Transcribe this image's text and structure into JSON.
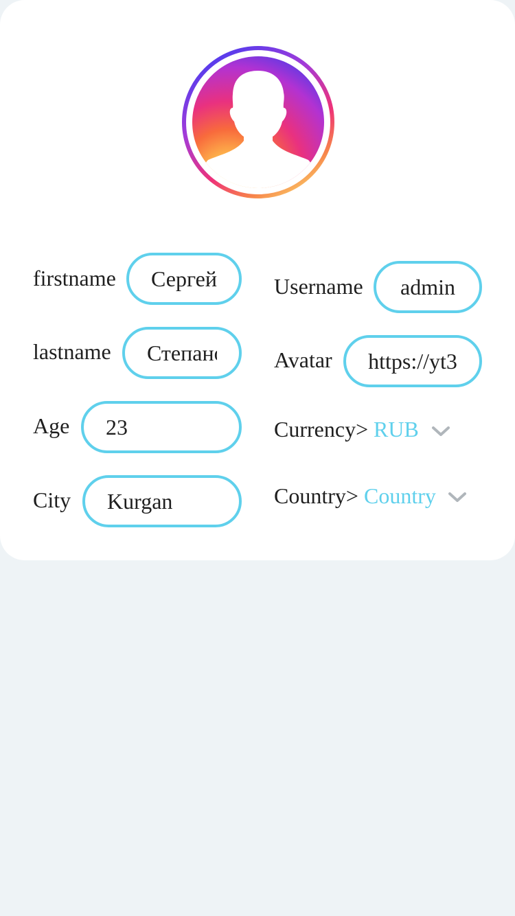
{
  "profile": {
    "avatar_icon": "user-silhouette-icon",
    "fields": {
      "firstname": {
        "label": "firstname",
        "value": "Сергей"
      },
      "lastname": {
        "label": "lastname",
        "value": "Степанов"
      },
      "age": {
        "label": "Age",
        "value": "23"
      },
      "city": {
        "label": "City",
        "value": "Kurgan"
      },
      "username": {
        "label": "Username",
        "value": "admin"
      },
      "avatar": {
        "label": "Avatar",
        "value": "https://yt3"
      }
    },
    "currency": {
      "label": "Currency>",
      "selected": "RUB",
      "icon": "chevron-down-icon"
    },
    "country": {
      "label": "Country>",
      "selected": "Country",
      "icon": "chevron-down-icon"
    }
  },
  "colors": {
    "background": "#eef3f6",
    "card": "#ffffff",
    "accent": "#5fd0ec",
    "chevron": "#b0b6bb"
  }
}
